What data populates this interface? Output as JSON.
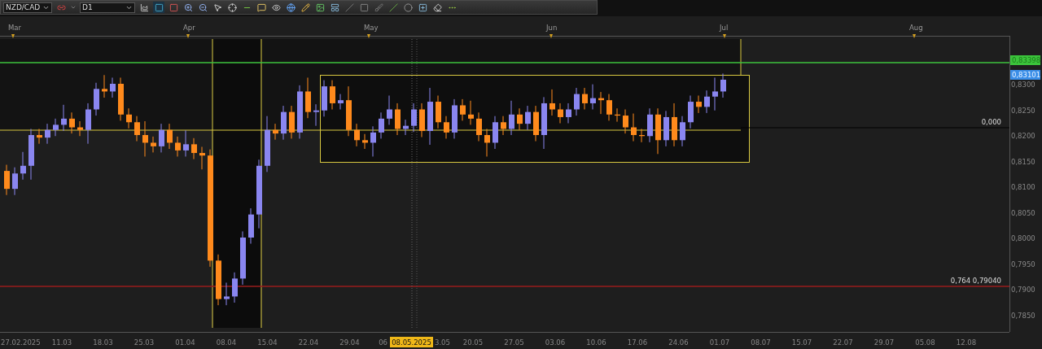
{
  "toolbar": {
    "symbol": "NZD/CAD",
    "timeframe": "D1"
  },
  "month_labels": [
    "Mar",
    "Apr",
    "May",
    "Jun",
    "Jul",
    "Aug"
  ],
  "price_labels": [
    "0,8300",
    "0,8250",
    "0,8200",
    "0,8150",
    "0,8100",
    "0,8050",
    "0,8000",
    "0,7950",
    "0,7900",
    "0,7850"
  ],
  "price_markers": [
    {
      "text": "0,83398",
      "kind": "alert"
    },
    {
      "text": "0,83101",
      "kind": "bid"
    }
  ],
  "level_labels": [
    {
      "text": "0,000",
      "kind": "zero"
    },
    {
      "text": "0,764 0,79040",
      "kind": "fibo"
    }
  ],
  "date_labels": [
    {
      "text": "27.02.2025",
      "kind": "first"
    },
    {
      "text": "11.03",
      "kind": "tick"
    },
    {
      "text": "18.03",
      "kind": "tick"
    },
    {
      "text": "25.03",
      "kind": "tick"
    },
    {
      "text": "01.04",
      "kind": "tick"
    },
    {
      "text": "08.04",
      "kind": "tick"
    },
    {
      "text": "15.04",
      "kind": "tick"
    },
    {
      "text": "22.04",
      "kind": "tick"
    },
    {
      "text": "29.04",
      "kind": "tick"
    },
    {
      "text": "06",
      "kind": "cut_end"
    },
    {
      "text": "3.05",
      "kind": "cut_start"
    },
    {
      "text": "20.05",
      "kind": "tick"
    },
    {
      "text": "27.05",
      "kind": "tick"
    },
    {
      "text": "03.06",
      "kind": "tick"
    },
    {
      "text": "10.06",
      "kind": "tick"
    },
    {
      "text": "17.06",
      "kind": "tick"
    },
    {
      "text": "24.06",
      "kind": "tick"
    },
    {
      "text": "01.07",
      "kind": "tick"
    },
    {
      "text": "08.07",
      "kind": "tick"
    },
    {
      "text": "15.07",
      "kind": "tick"
    },
    {
      "text": "22.07",
      "kind": "tick"
    },
    {
      "text": "29.07",
      "kind": "tick"
    },
    {
      "text": "05.08",
      "kind": "tick"
    },
    {
      "text": "12.08",
      "kind": "tick"
    }
  ],
  "cursor_date": "08.05.2025"
}
